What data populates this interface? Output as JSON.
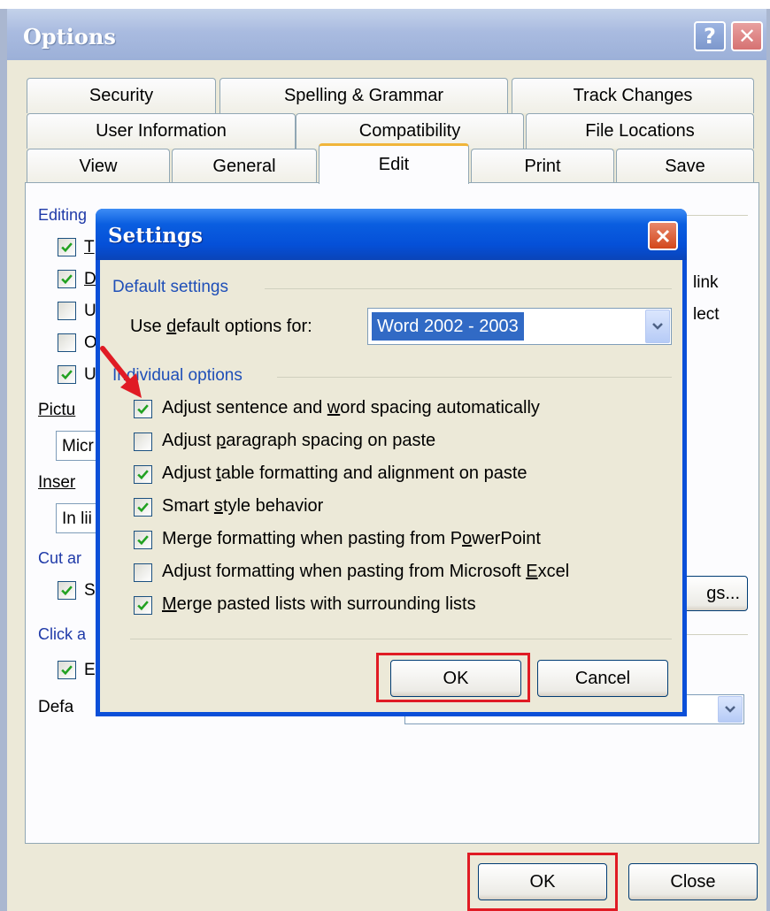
{
  "window": {
    "title": "Options",
    "help_label": "?",
    "close_label": "✕"
  },
  "tabs": {
    "row1": [
      "Security",
      "Spelling & Grammar",
      "Track Changes"
    ],
    "row2": [
      "User Information",
      "Compatibility",
      "File Locations"
    ],
    "row3": [
      "View",
      "General",
      "Edit",
      "Print",
      "Save"
    ],
    "active": "Edit"
  },
  "edit_panel": {
    "editing_group": "Editing",
    "editing_checks": [
      {
        "text": "T",
        "checked": true
      },
      {
        "text": "D",
        "checked": true
      },
      {
        "text": "U",
        "checked": false
      },
      {
        "text": "O",
        "checked": false
      },
      {
        "text": "U",
        "checked": true
      }
    ],
    "right_fragments": [
      "link",
      "lect"
    ],
    "picture_label": "Pictu",
    "picture_value": "Micr",
    "insert_label": "Inser",
    "insert_value": "In lii",
    "cut_group": "Cut ar",
    "cut_check": {
      "text": "S",
      "checked": true
    },
    "settings_btn_fragment": "gs...",
    "click_group": "Click a",
    "click_check": {
      "text": "E",
      "checked": true
    },
    "default_label": "Defa"
  },
  "footer": {
    "ok_label": "OK",
    "close_label": "Close"
  },
  "settings_dialog": {
    "title": "Settings",
    "default_group": "Default settings",
    "use_default_label_pre": "Use ",
    "use_default_label_u": "d",
    "use_default_label_post": "efault options for:",
    "use_default_value": "Word 2002 - 2003",
    "individual_group": "Individual options",
    "options": [
      {
        "pre": "Adjust sentence and ",
        "u": "w",
        "post": "ord spacing automatically",
        "checked": true
      },
      {
        "pre": "Adjust ",
        "u": "p",
        "post": "aragraph spacing on paste",
        "checked": false
      },
      {
        "pre": "Adjust ",
        "u": "t",
        "post": "able formatting and alignment on paste",
        "checked": true
      },
      {
        "pre": "Smart ",
        "u": "s",
        "post": "tyle behavior",
        "checked": true
      },
      {
        "pre": "Merge formatting when pasting from P",
        "u": "o",
        "post": "werPoint",
        "checked": true
      },
      {
        "pre": "Adjust formatting when pasting from Microsoft ",
        "u": "E",
        "post": "xcel",
        "checked": false
      },
      {
        "pre": "",
        "u": "M",
        "post": "erge pasted lists with surrounding lists",
        "checked": true
      }
    ],
    "ok_label": "OK",
    "cancel_label": "Cancel"
  },
  "colors": {
    "highlight_box": "#e01b24",
    "settings_titlebar": "#0550d8",
    "options_titlebar": "#a9bbe0",
    "active_tab_accent": "#f0b53a",
    "group_label": "#1f4fb8"
  }
}
